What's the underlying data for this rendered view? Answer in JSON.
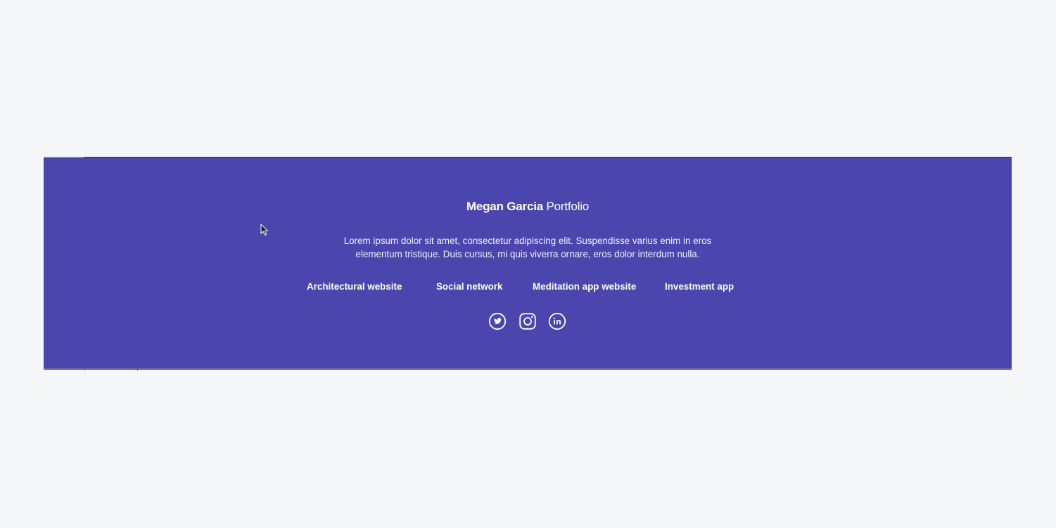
{
  "footer": {
    "brand_name": "Megan Garcia",
    "brand_suffix": "Portfolio",
    "description": "Lorem ipsum dolor sit amet, consectetur adipiscing elit. Suspendisse varius enim in eros elementum tristique. Duis cursus, mi quis viverra ornare, eros dolor interdum nulla.",
    "links": [
      {
        "label": "Architectural website"
      },
      {
        "label": "Social network"
      },
      {
        "label": "Meditation app website"
      },
      {
        "label": "Investment app"
      }
    ],
    "social": [
      {
        "icon": "twitter-icon"
      },
      {
        "icon": "instagram-icon"
      },
      {
        "icon": "linkedin-icon"
      }
    ]
  },
  "colors": {
    "page_background": "#f6f7f9",
    "footer_background": "#4a46ad",
    "text": "#ffffff"
  }
}
